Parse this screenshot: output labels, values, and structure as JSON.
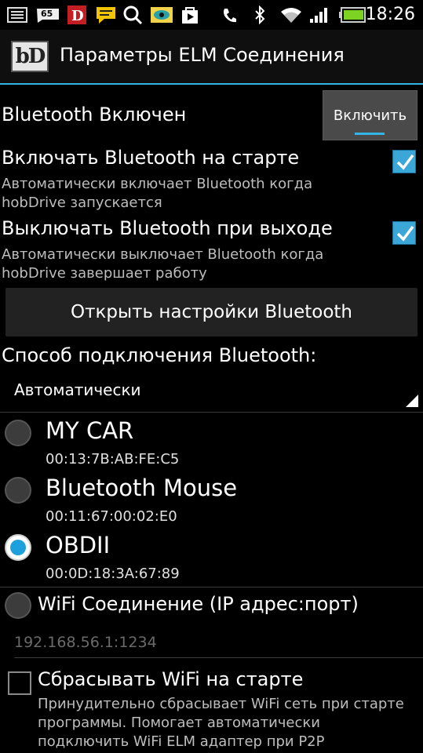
{
  "status_bar": {
    "time": "18:26",
    "notification_badge": "65",
    "icons": [
      "screenshot-icon",
      "sms-badge-icon",
      "d-app-icon",
      "message-icon",
      "search-icon",
      "eye-app-icon",
      "play-store-icon",
      "phone-icon",
      "bluetooth-icon",
      "wifi-icon",
      "signal-icon",
      "battery-icon"
    ]
  },
  "action_bar": {
    "logo_text": "bD",
    "title": "Параметры ELM Соединения"
  },
  "settings": {
    "bt_enabled_label": "Bluetooth Включен",
    "bt_enable_button": "Включить",
    "bt_on_start": {
      "title": "Включать Bluetooth на старте",
      "summary": "Автоматически включает Bluetooth когда hobDrive запускается",
      "checked": true
    },
    "bt_off_exit": {
      "title": "Выключать Bluetooth при выходе",
      "summary": "Автоматически выключает Bluetooth когда hobDrive завершает работу",
      "checked": true
    },
    "open_bt_settings_button": "Открыть настройки Bluetooth",
    "bt_connection_method_label": "Способ подключения Bluetooth:",
    "bt_connection_method_value": "Автоматически"
  },
  "devices": [
    {
      "name": "MY CAR",
      "mac": "00:13:7B:AB:FE:C5",
      "selected": false
    },
    {
      "name": "Bluetooth Mouse",
      "mac": "00:11:67:00:02:E0",
      "selected": false
    },
    {
      "name": "OBDII",
      "mac": "00:0D:18:3A:67:89",
      "selected": true
    }
  ],
  "wifi": {
    "label": "WiFi Соединение (IP адрес:порт)",
    "address_placeholder": "192.168.56.1:1234",
    "reset_on_start": {
      "title": "Сбрасывать WiFi на старте",
      "summary": "Принудительно сбрасывает WiFi сеть при старте программы. Помогает автоматически подключить WiFi ELM адаптер при P2P",
      "checked": false
    }
  },
  "colors": {
    "accent": "#33b5e5",
    "checkbox": "#3aa7d8",
    "radio_selected": "#1ea0dc",
    "battery": "#7dd321"
  }
}
